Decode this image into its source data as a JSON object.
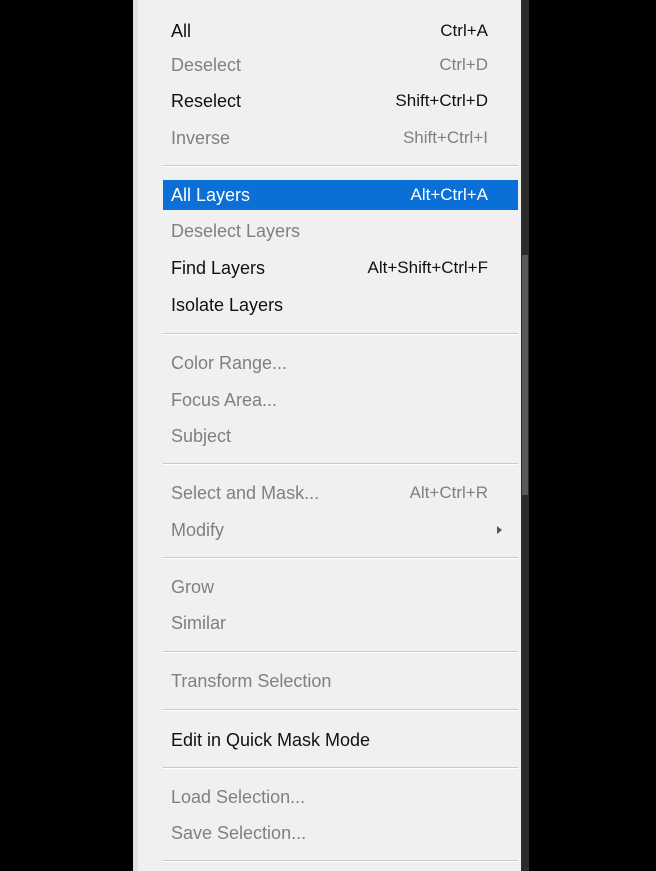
{
  "menu": {
    "items": [
      {
        "label": "All",
        "shortcut": "Ctrl+A"
      },
      {
        "label": "Deselect",
        "shortcut": "Ctrl+D"
      },
      {
        "label": "Reselect",
        "shortcut": "Shift+Ctrl+D"
      },
      {
        "label": "Inverse",
        "shortcut": "Shift+Ctrl+I"
      },
      {
        "label": "All Layers",
        "shortcut": "Alt+Ctrl+A"
      },
      {
        "label": "Deselect Layers",
        "shortcut": ""
      },
      {
        "label": "Find Layers",
        "shortcut": "Alt+Shift+Ctrl+F"
      },
      {
        "label": "Isolate Layers",
        "shortcut": ""
      },
      {
        "label": "Color Range...",
        "shortcut": ""
      },
      {
        "label": "Focus Area...",
        "shortcut": ""
      },
      {
        "label": "Subject",
        "shortcut": ""
      },
      {
        "label": "Select and Mask...",
        "shortcut": "Alt+Ctrl+R"
      },
      {
        "label": "Modify",
        "shortcut": ""
      },
      {
        "label": "Grow",
        "shortcut": ""
      },
      {
        "label": "Similar",
        "shortcut": ""
      },
      {
        "label": "Transform Selection",
        "shortcut": ""
      },
      {
        "label": "Edit in Quick Mask Mode",
        "shortcut": ""
      },
      {
        "label": "Load Selection...",
        "shortcut": ""
      },
      {
        "label": "Save Selection...",
        "shortcut": ""
      }
    ]
  },
  "colors": {
    "menu_background": "#f0f0f0",
    "highlight": "#0a6fd6",
    "enabled_text": "#111111",
    "disabled_text": "#808080"
  },
  "icons": {
    "submenu": "submenu-arrow-icon"
  }
}
